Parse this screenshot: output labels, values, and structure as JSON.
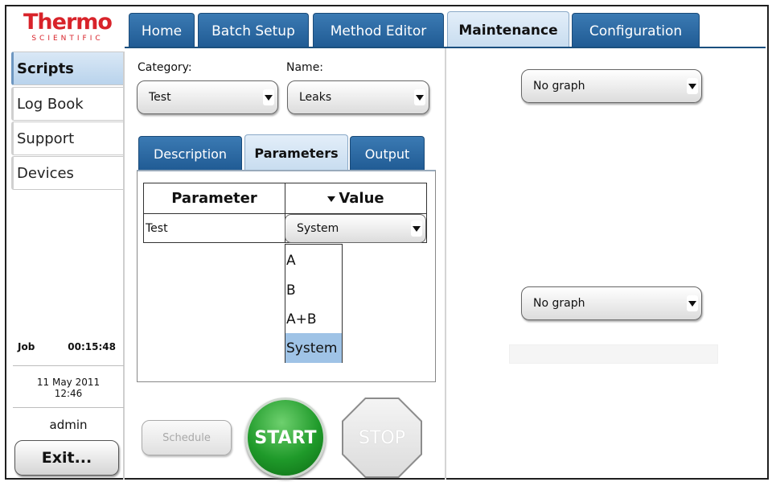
{
  "logo": {
    "main": "Thermo",
    "sub": "SCIENTIFIC"
  },
  "top_tabs": [
    {
      "label": "Home"
    },
    {
      "label": "Batch Setup"
    },
    {
      "label": "Method Editor"
    },
    {
      "label": "Maintenance",
      "active": true
    },
    {
      "label": "Configuration"
    }
  ],
  "sidebar": {
    "items": [
      {
        "label": "Scripts",
        "active": true
      },
      {
        "label": "Log Book"
      },
      {
        "label": "Support"
      },
      {
        "label": "Devices"
      }
    ],
    "job_label": "Job",
    "job_time": "00:15:48",
    "date": "11 May 2011",
    "time": "12:46",
    "user": "admin",
    "exit_label": "Exit..."
  },
  "form": {
    "category_label": "Category:",
    "category_value": "Test",
    "name_label": "Name:",
    "name_value": "Leaks"
  },
  "sub_tabs": [
    {
      "label": "Description"
    },
    {
      "label": "Parameters",
      "active": true
    },
    {
      "label": "Output"
    }
  ],
  "params_table": {
    "headers": [
      "Parameter",
      "Value"
    ],
    "rows": [
      {
        "parameter": "Test",
        "value": "System"
      }
    ]
  },
  "value_dropdown": {
    "options": [
      "A",
      "B",
      "A+B",
      "System"
    ],
    "selected": "System"
  },
  "buttons": {
    "schedule": "Schedule",
    "start": "START",
    "stop": "STOP"
  },
  "graphs": {
    "top_select": "No graph",
    "bottom_select": "No graph"
  },
  "colors": {
    "brand": "#d8232a",
    "tab_blue": "#2b6aa5",
    "start_green": "#1f9a2a",
    "selection": "#9fc3e6"
  }
}
